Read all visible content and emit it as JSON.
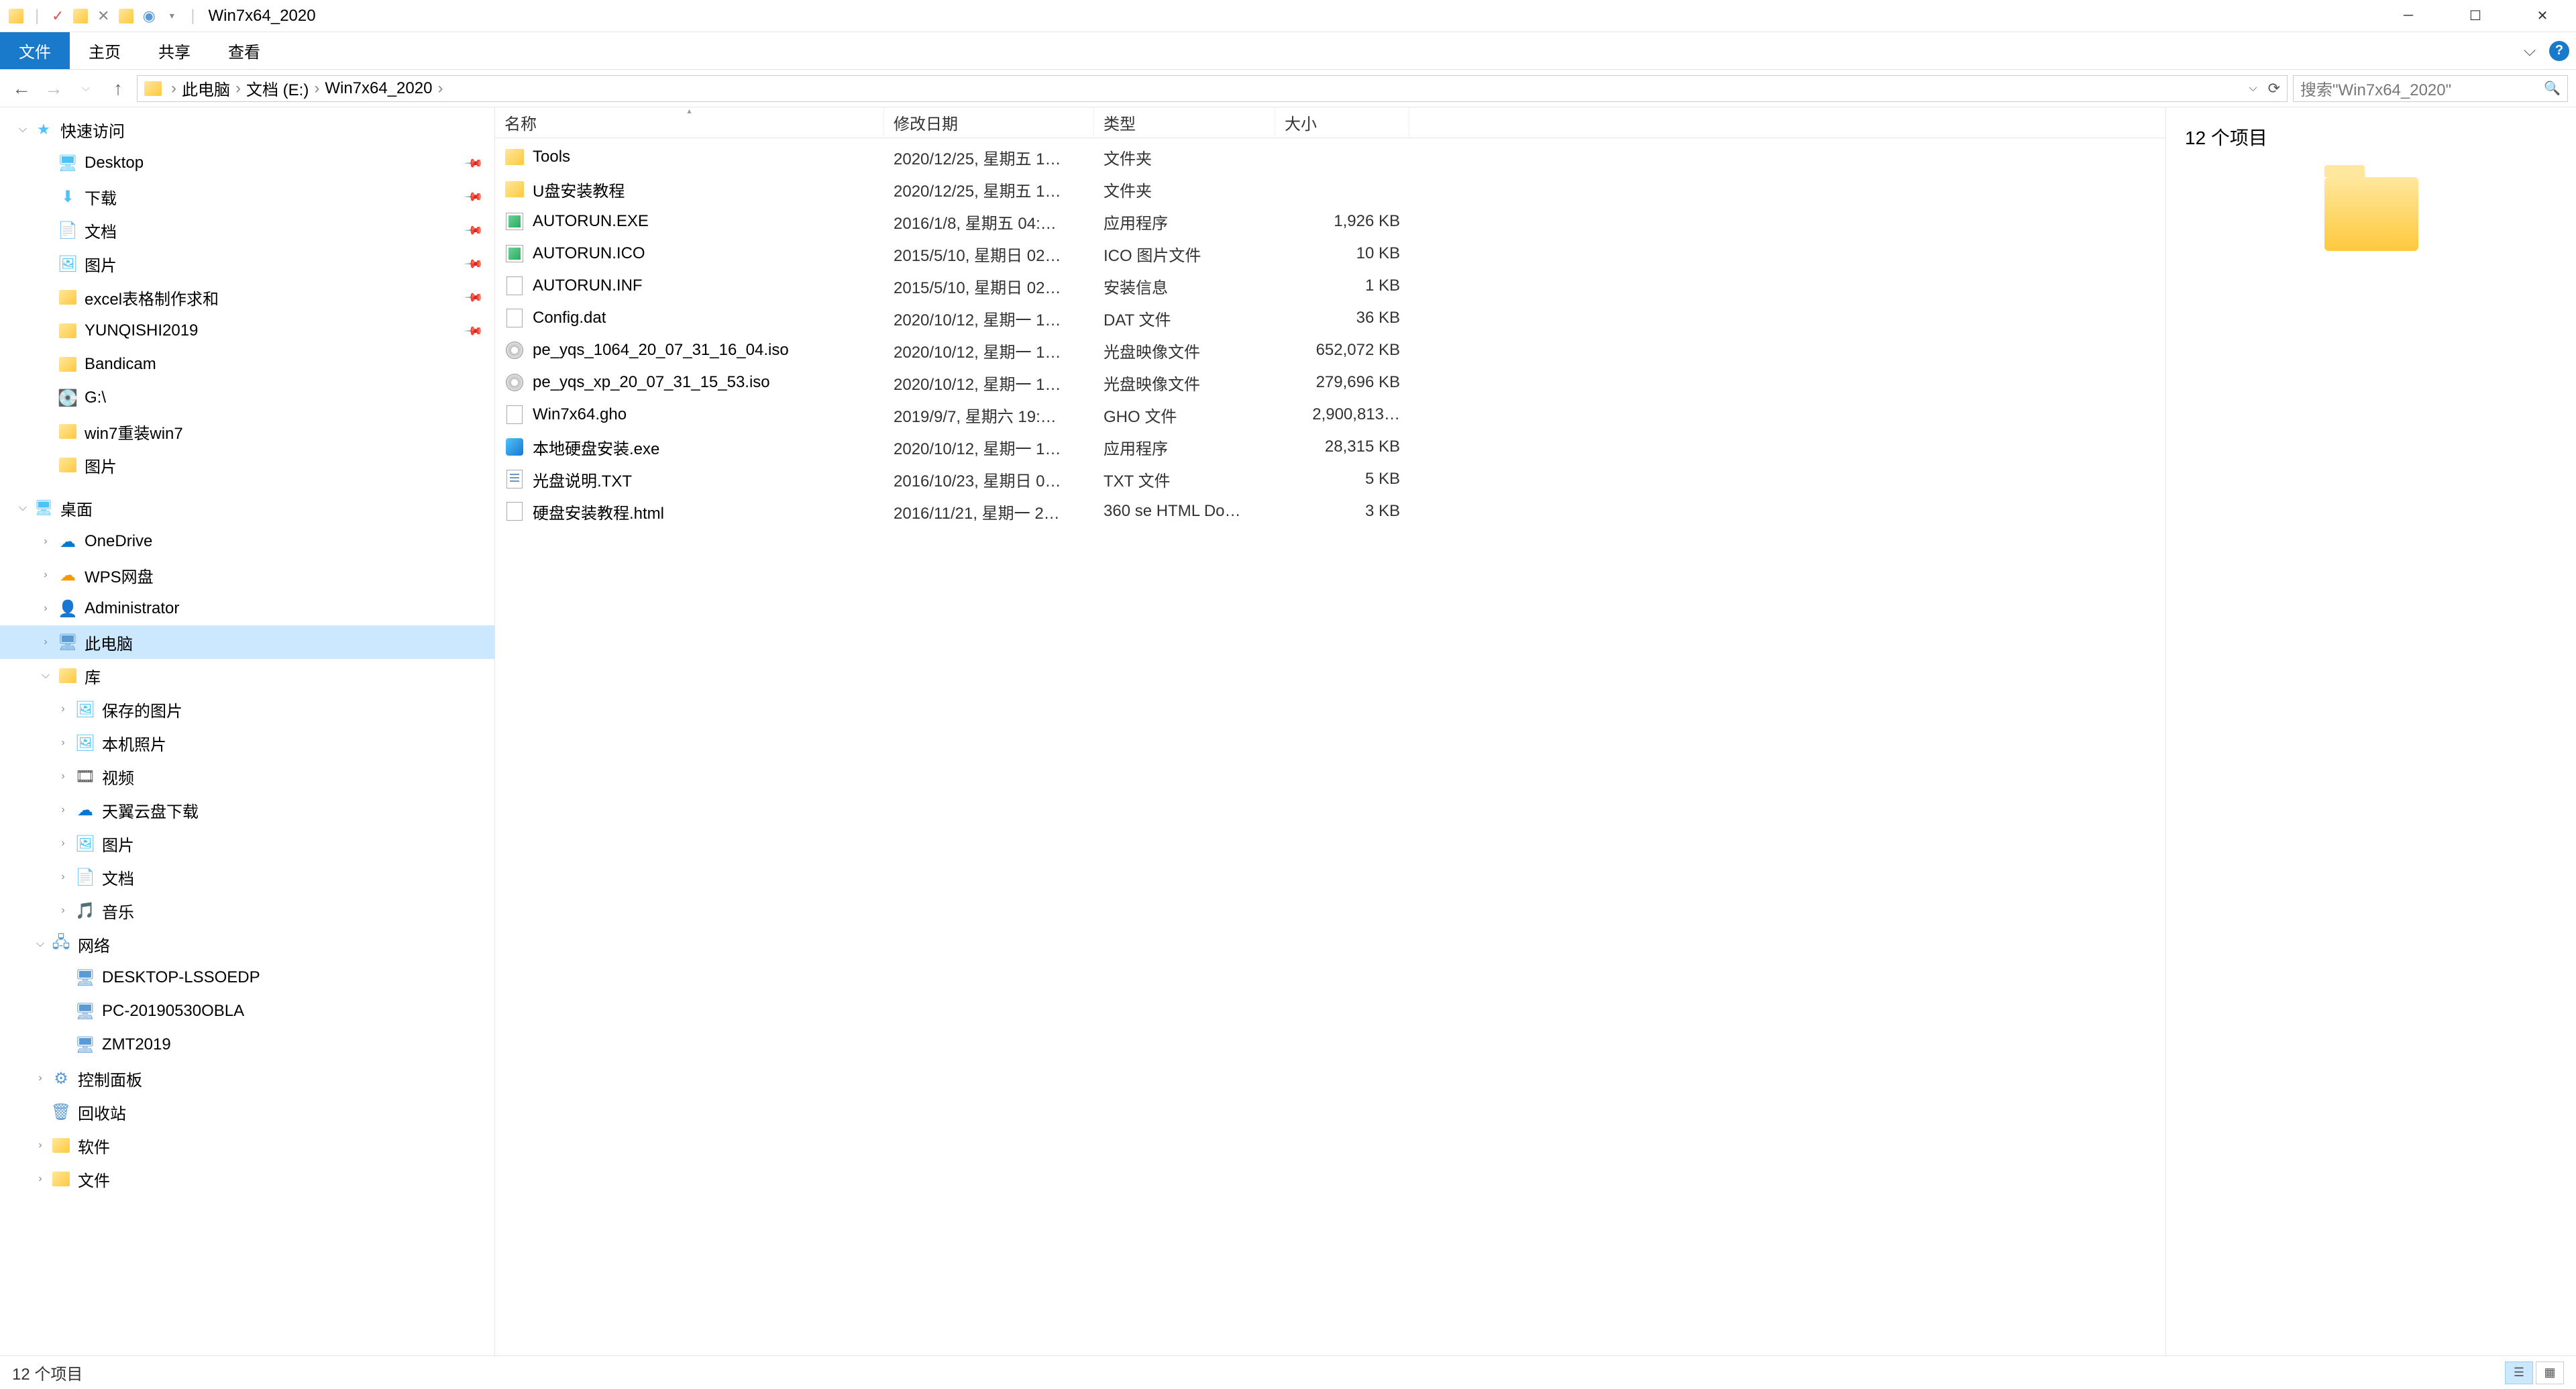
{
  "window": {
    "title": "Win7x64_2020"
  },
  "ribbon": {
    "tabs": {
      "file": "文件",
      "home": "主页",
      "share": "共享",
      "view": "查看"
    }
  },
  "breadcrumb": {
    "segments": [
      "此电脑",
      "文档 (E:)",
      "Win7x64_2020"
    ]
  },
  "search": {
    "placeholder": "搜索\"Win7x64_2020\""
  },
  "columns": {
    "name": "名称",
    "date": "修改日期",
    "type": "类型",
    "size": "大小"
  },
  "tree": {
    "quick": "快速访问",
    "quick_items": [
      {
        "name": "Desktop",
        "icon": "desktop",
        "pin": true
      },
      {
        "name": "下载",
        "icon": "dl",
        "pin": true
      },
      {
        "name": "文档",
        "icon": "doc",
        "pin": true
      },
      {
        "name": "图片",
        "icon": "pic",
        "pin": true
      },
      {
        "name": "excel表格制作求和",
        "icon": "folder",
        "pin": true
      },
      {
        "name": "YUNQISHI2019",
        "icon": "folder",
        "pin": true
      },
      {
        "name": "Bandicam",
        "icon": "folder"
      },
      {
        "name": "G:\\",
        "icon": "disk"
      },
      {
        "name": "win7重装win7",
        "icon": "folder"
      },
      {
        "name": "图片",
        "icon": "folder"
      }
    ],
    "desktop": "桌面",
    "desktop_items": [
      {
        "name": "OneDrive",
        "icon": "cloud"
      },
      {
        "name": "WPS网盘",
        "icon": "wps"
      },
      {
        "name": "Administrator",
        "icon": "user"
      },
      {
        "name": "此电脑",
        "icon": "pc",
        "selected": true
      },
      {
        "name": "库",
        "icon": "lib"
      }
    ],
    "lib_items": [
      {
        "name": "保存的图片",
        "icon": "pic"
      },
      {
        "name": "本机照片",
        "icon": "pic"
      },
      {
        "name": "视频",
        "icon": "vid"
      },
      {
        "name": "天翼云盘下载",
        "icon": "cloud"
      },
      {
        "name": "图片",
        "icon": "pic"
      },
      {
        "name": "文档",
        "icon": "doc"
      },
      {
        "name": "音乐",
        "icon": "music"
      }
    ],
    "network": "网络",
    "net_items": [
      {
        "name": "DESKTOP-LSSOEDP",
        "icon": "pc"
      },
      {
        "name": "PC-20190530OBLA",
        "icon": "pc"
      },
      {
        "name": "ZMT2019",
        "icon": "pc"
      }
    ],
    "ctrl": "控制面板",
    "recycle": "回收站",
    "soft": "软件",
    "files": "文件"
  },
  "files": [
    {
      "name": "Tools",
      "date": "2020/12/25, 星期五 1…",
      "type": "文件夹",
      "size": "",
      "icon": "folder"
    },
    {
      "name": "U盘安装教程",
      "date": "2020/12/25, 星期五 1…",
      "type": "文件夹",
      "size": "",
      "icon": "folder"
    },
    {
      "name": "AUTORUN.EXE",
      "date": "2016/1/8, 星期五 04:…",
      "type": "应用程序",
      "size": "1,926 KB",
      "icon": "exe"
    },
    {
      "name": "AUTORUN.ICO",
      "date": "2015/5/10, 星期日 02…",
      "type": "ICO 图片文件",
      "size": "10 KB",
      "icon": "exe"
    },
    {
      "name": "AUTORUN.INF",
      "date": "2015/5/10, 星期日 02…",
      "type": "安装信息",
      "size": "1 KB",
      "icon": "file"
    },
    {
      "name": "Config.dat",
      "date": "2020/10/12, 星期一 1…",
      "type": "DAT 文件",
      "size": "36 KB",
      "icon": "file"
    },
    {
      "name": "pe_yqs_1064_20_07_31_16_04.iso",
      "date": "2020/10/12, 星期一 1…",
      "type": "光盘映像文件",
      "size": "652,072 KB",
      "icon": "iso"
    },
    {
      "name": "pe_yqs_xp_20_07_31_15_53.iso",
      "date": "2020/10/12, 星期一 1…",
      "type": "光盘映像文件",
      "size": "279,696 KB",
      "icon": "iso"
    },
    {
      "name": "Win7x64.gho",
      "date": "2019/9/7, 星期六 19:…",
      "type": "GHO 文件",
      "size": "2,900,813…",
      "icon": "gho"
    },
    {
      "name": "本地硬盘安装.exe",
      "date": "2020/10/12, 星期一 1…",
      "type": "应用程序",
      "size": "28,315 KB",
      "icon": "app"
    },
    {
      "name": "光盘说明.TXT",
      "date": "2016/10/23, 星期日 0…",
      "type": "TXT 文件",
      "size": "5 KB",
      "icon": "txt"
    },
    {
      "name": "硬盘安装教程.html",
      "date": "2016/11/21, 星期一 2…",
      "type": "360 se HTML Do…",
      "size": "3 KB",
      "icon": "html"
    }
  ],
  "preview": {
    "heading": "12 个项目"
  },
  "status": {
    "text": "12 个项目"
  }
}
